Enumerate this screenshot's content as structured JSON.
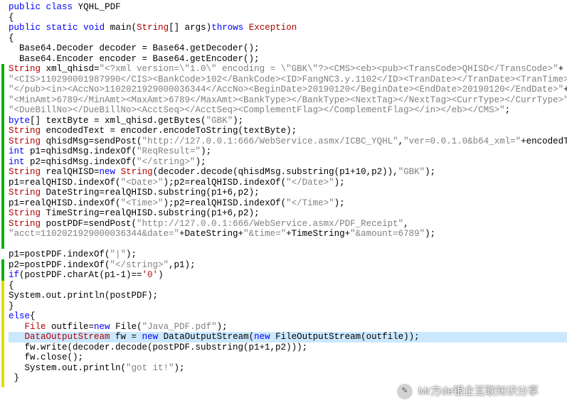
{
  "code": {
    "l1_kw1": "public",
    "l1_kw2": "class",
    "l1_cls": "YQHL_PDF",
    "l3_kw1": "public",
    "l3_kw2": "static",
    "l3_kw3": "void",
    "l3_mname": "main",
    "l3_argtype": "String",
    "l3_argname": "args",
    "l3_throws": "throws",
    "l3_exc": "Exception",
    "l5a": "  Base64.Decoder decoder = Base64.getDecoder();",
    "l5b": "  Base64.Encoder encoder = Base64.getEncoder();",
    "l6_typ": "String",
    "l6_var": " xml_qhisd=",
    "l6_s1": "\"<?xml version=\\\"1.0\\\" encoding = \\\"GBK\\\"?><CMS><eb><pub><TransCode>QHISD</TransCode>\"",
    "l7_s": "\"<CIS>110290001987990</CIS><BankCode>102</BankCode><ID>FangNC3.y.1102</ID><TranDate></TranDate><TranTime></TranT",
    "l8_s": "\"</pub><in><AccNo>1102021929000036344</AccNo><BeginDate>20190120</BeginDate><EndDate>20190120</EndDate>\"",
    "l9_s": "\"<MinAmt>6789</MinAmt><MaxAmt>6789</MaxAmt><BankType></BankType><NextTag></NextTag><CurrType></CurrType>\"",
    "l10_s": "\"<DueBillNo></DueBillNo><AcctSeq></AcctSeq><ComplementFlag></ComplementFlag></in></eb></CMS>\"",
    "l11_typ": "byte",
    "l11_rest": "[] textByte = xml_qhisd.getBytes(",
    "l11_str": "\"GBK\"",
    "l11_end": ");",
    "l12_typ": "String",
    "l12_rest": " encodedText = encoder.encodeToString(textByte);",
    "l13_typ": "String",
    "l13_a": " qhisdMsg=sendPost(",
    "l13_s1": "\"http://127.0.0.1:666/WebService.asmx/ICBC_YQHL\"",
    "l13_b": ",",
    "l13_s2": "\"ver=0.0.1.0&b64_xml=\"",
    "l13_c": "+encodedText);",
    "l14_typ": "int",
    "l14_rest": " p1=qhisdMsg.indexOf(",
    "l14_str": "\"ReqResult=\"",
    "l14_end": ");",
    "l15_typ": "int",
    "l15_rest": " p2=qhisdMsg.indexOf(",
    "l15_str": "\"</string>\"",
    "l15_end": ");",
    "l16_typ": "String",
    "l16_a": " realQHISD=",
    "l16_kw": "new",
    "l16_b": " ",
    "l16_cls": "String",
    "l16_c": "(decoder.decode(qhisdMsg.substring(p1+10,p2)),",
    "l16_str": "\"GBK\"",
    "l16_end": ");",
    "l17_a": "p1=realQHISD.indexOf(",
    "l17_s1": "\"<Date>\"",
    "l17_b": ");p2=realQHISD.indexOf(",
    "l17_s2": "\"</Date>\"",
    "l17_end": ");",
    "l18_typ": "String",
    "l18_rest": " DateString=realQHISD.substring(p1+6,p2);",
    "l19_a": "p1=realQHISD.indexOf(",
    "l19_s1": "\"<Time>\"",
    "l19_b": ");p2=realQHISD.indexOf(",
    "l19_s2": "\"</Time>\"",
    "l19_end": ");",
    "l20_typ": "String",
    "l20_rest": " TimeString=realQHISD.substring(p1+6,p2);",
    "l21_typ": "String",
    "l21_a": " postPDF=sendPost(",
    "l21_s1": "\"http://127.0.0.1:666/WebService.asmx/PDF_Receipt\"",
    "l21_end": ",",
    "l22_s1": "\"acct=1102021929000036344&date=\"",
    "l22_a": "+DateString+",
    "l22_s2": "\"&time=\"",
    "l22_b": "+TimeString+",
    "l22_s3": "\"&amount=6789\"",
    "l22_end": ");",
    "l24_a": "p1=postPDF.indexOf(",
    "l24_s": "\"|\"",
    "l24_end": ");",
    "l25_a": "p2=postPDF.indexOf(",
    "l25_s": "\"</string>\"",
    "l25_b": ",p1);",
    "l26_kw": "if",
    "l26_a": "(postPDF.charAt(p1-1)==",
    "l26_s": "'0'",
    "l26_end": ")",
    "l28": "System.out.println(postPDF);",
    "l30_kw": "else",
    "l31_typ": "File",
    "l31_a": " outfile=",
    "l31_kw": "new",
    "l31_b": " File(",
    "l31_s": "\"Java_PDF.pdf\"",
    "l31_end": ");",
    "l32_typ": "DataOutputStream",
    "l32_a": " fw = ",
    "l32_kw": "new",
    "l32_b": " DataOutputStream(",
    "l32_kw2": "new",
    "l32_c": " FileOutputStream(outfile));",
    "l33": "   fw.write(decoder.decode(postPDF.substring(p1+1,p2)));",
    "l34": "   fw.close();",
    "l35_a": "   System.out.println(",
    "l35_s": "\"got it!\"",
    "l35_end": ");"
  },
  "watermark": {
    "text": "Mr方de银企互联知识分享",
    "icon_glyph": "✎"
  }
}
